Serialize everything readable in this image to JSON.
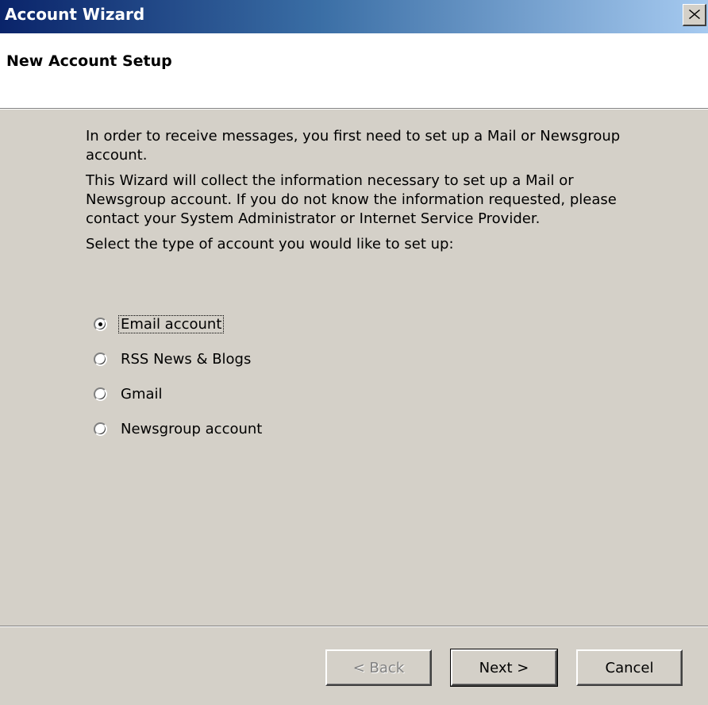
{
  "window": {
    "title": "Account Wizard",
    "close_glyph": "✕"
  },
  "header": {
    "title": "New Account Setup"
  },
  "body": {
    "paragraph_1": "In order to receive messages, you first need to set up a Mail or Newsgroup account.",
    "paragraph_2": "This Wizard will collect the information necessary to set up a Mail or Newsgroup account. If you do not know the information requested, please contact your System Administrator or Internet Service Provider.",
    "prompt": "Select the type of account you would like to set up:"
  },
  "account_types": [
    {
      "label": "Email account",
      "selected": true
    },
    {
      "label": "RSS News & Blogs",
      "selected": false
    },
    {
      "label": "Gmail",
      "selected": false
    },
    {
      "label": "Newsgroup account",
      "selected": false
    }
  ],
  "buttons": {
    "back": "< Back",
    "next": "Next >",
    "cancel": "Cancel"
  },
  "colors": {
    "titlebar_start": "#0a246a",
    "titlebar_end": "#a6caf0",
    "dialog_face": "#d4d0c8"
  }
}
